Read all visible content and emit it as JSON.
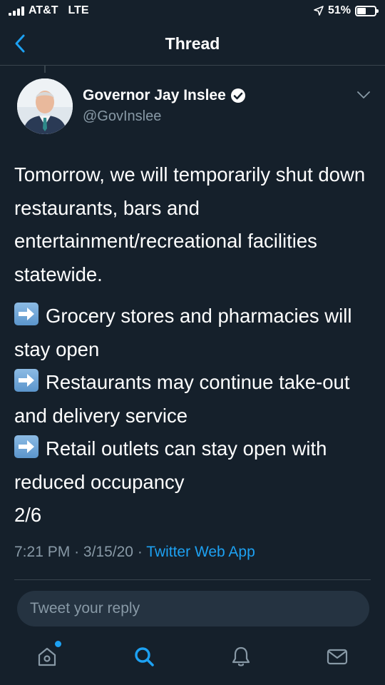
{
  "status": {
    "carrier": "AT&T",
    "network": "LTE",
    "battery": "51%",
    "battery_level": 0.51
  },
  "nav": {
    "title": "Thread"
  },
  "author": {
    "name": "Governor Jay Inslee",
    "handle": "@GovInslee",
    "verified": true
  },
  "tweet": {
    "intro": "Tomorrow, we will temporarily shut down restaurants, bars and entertainment/recreational facilities statewide.",
    "bullets": [
      "Grocery stores and pharmacies will stay open",
      "Restaurants may continue take-out and delivery service",
      "Retail outlets can stay open with reduced occupancy"
    ],
    "counter": "2/6"
  },
  "meta": {
    "time": "7:21 PM",
    "date": "3/15/20",
    "source": "Twitter Web App"
  },
  "reply": {
    "placeholder": "Tweet your reply"
  },
  "tabs": [
    "home-icon",
    "search-icon",
    "notifications-icon",
    "messages-icon"
  ],
  "colors": {
    "background": "#15202b",
    "accent": "#1da1f2",
    "muted": "#8899a6"
  }
}
